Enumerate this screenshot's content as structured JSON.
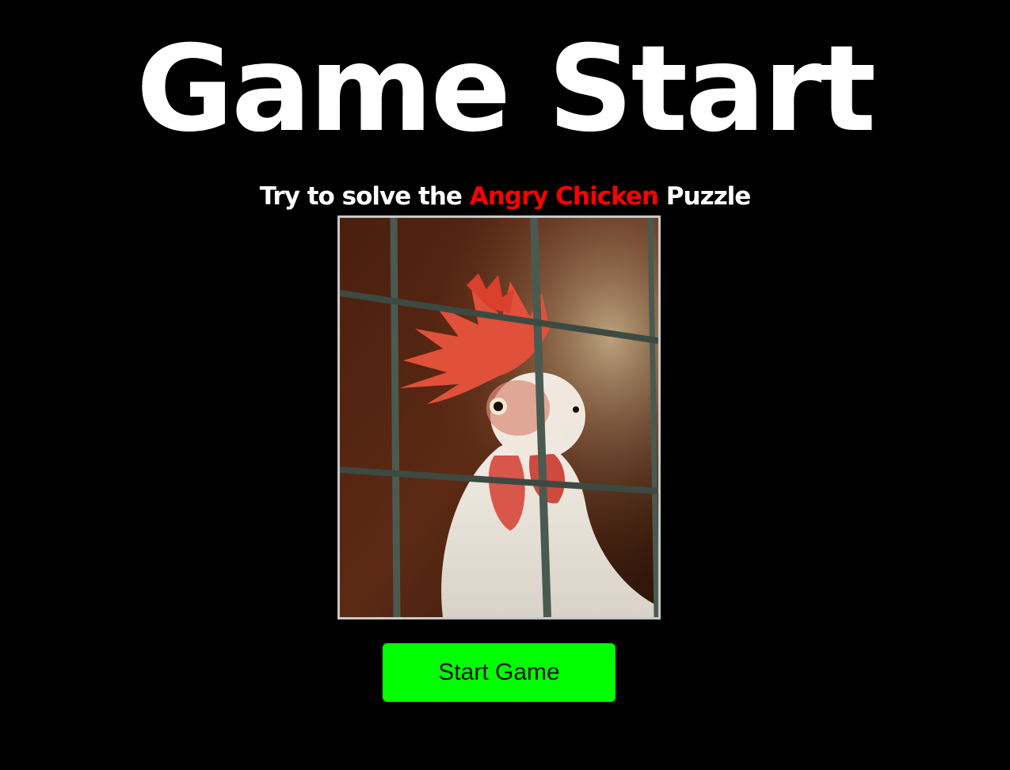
{
  "page": {
    "title": "Game Start",
    "subtitle_prefix": "Try to solve the ",
    "subtitle_highlight": "Angry Chicken",
    "subtitle_suffix": " Puzzle",
    "start_button_label": "Start Game"
  },
  "colors": {
    "background": "#000000",
    "title": "#ffffff",
    "highlight": "#ff0000",
    "button": "#00ff00",
    "frame_border": "#c8c8c8"
  },
  "image": {
    "subject": "white rooster with red comb behind wire cage"
  }
}
